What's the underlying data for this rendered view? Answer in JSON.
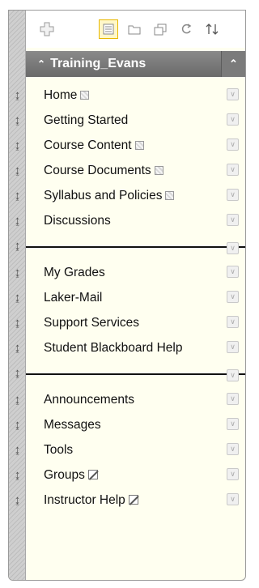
{
  "toolbar": {
    "add_icon": "add-menu-item-icon",
    "icons": [
      "list-view-icon",
      "folder-view-icon",
      "new-window-icon",
      "refresh-icon",
      "reorder-icon"
    ]
  },
  "course": {
    "title": "Training_Evans",
    "caret": "≈"
  },
  "menu": {
    "items": [
      {
        "label": "Home",
        "mark": "hidden"
      },
      {
        "label": "Getting Started",
        "mark": ""
      },
      {
        "label": "Course Content",
        "mark": "hidden"
      },
      {
        "label": "Course Documents",
        "mark": "hidden"
      },
      {
        "label": "Syllabus and Policies",
        "mark": "hidden"
      },
      {
        "label": "Discussions",
        "mark": ""
      },
      {
        "label": "My Grades",
        "mark": ""
      },
      {
        "label": "Laker-Mail",
        "mark": ""
      },
      {
        "label": "Support Services",
        "mark": ""
      },
      {
        "label": "Student Blackboard Help",
        "mark": ""
      },
      {
        "label": "Announcements",
        "mark": ""
      },
      {
        "label": "Messages",
        "mark": ""
      },
      {
        "label": "Tools",
        "mark": ""
      },
      {
        "label": "Groups",
        "mark": "no-access"
      },
      {
        "label": "Instructor Help",
        "mark": "no-access"
      }
    ]
  },
  "colors": {
    "menu_bg": "#fffff0",
    "header_bg": "#7a7a7a",
    "active_toolbar": "#e8b800"
  }
}
